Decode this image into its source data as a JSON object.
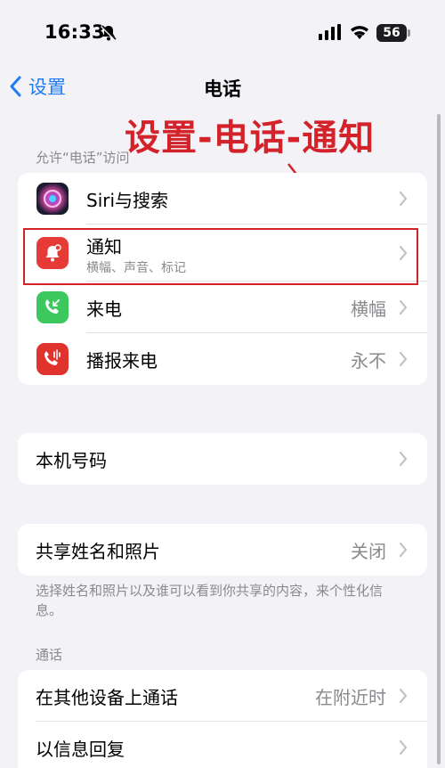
{
  "status_bar": {
    "time": "16:33",
    "battery": "56"
  },
  "nav": {
    "back_label": "设置",
    "title": "电话"
  },
  "annotation": {
    "text": "设置-电话-通知"
  },
  "sections": {
    "access_header": "允许“电话”访问",
    "access_items": [
      {
        "label": "Siri与搜索",
        "icon": "siri-icon"
      },
      {
        "label": "通知",
        "sublabel": "横幅、声音、标记",
        "icon": "notification-bell-icon"
      },
      {
        "label": "来电",
        "value": "横幅",
        "icon": "incoming-call-icon"
      },
      {
        "label": "播报来电",
        "value": "永不",
        "icon": "announce-calls-icon"
      }
    ],
    "my_number": {
      "label": "本机号码"
    },
    "share_name_photo": {
      "label": "共享姓名和照片",
      "value": "关闭",
      "footnote": "选择姓名和照片以及谁可以看到你共享的内容，来个性化信息。"
    },
    "calls_header": "通话",
    "calls_items": [
      {
        "label": "在其他设备上通话",
        "value": "在附近时"
      },
      {
        "label": "以信息回复"
      }
    ]
  },
  "colors": {
    "accent": "#1f7cf2",
    "annotation": "#d4222b",
    "phone_green": "#3cc85c",
    "notification_red": "#e53a35"
  }
}
